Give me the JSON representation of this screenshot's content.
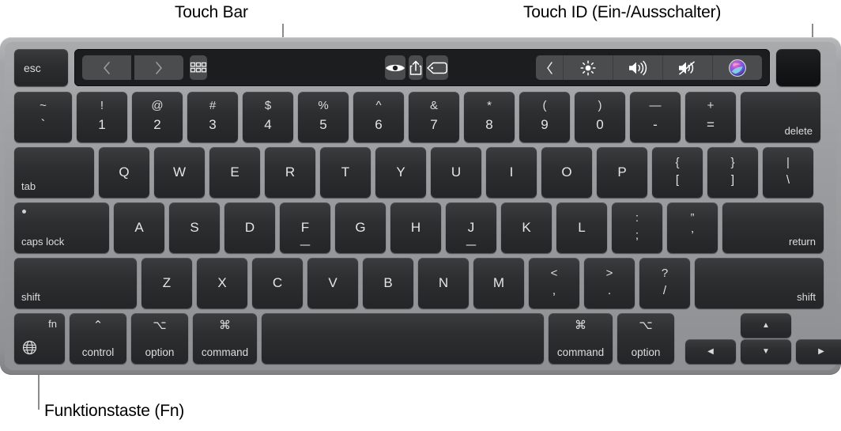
{
  "annotations": {
    "touch_bar": {
      "label": "Touch Bar"
    },
    "touch_id": {
      "label": "Touch ID (Ein-/Ausschalter)"
    },
    "fn_key": {
      "label": "Funktionstaste (Fn)"
    }
  },
  "colors": {
    "body": "#9a9c9f",
    "key": "#2c2e30",
    "key_text": "#e4e5e7",
    "touchbar_bg": "#1c1d1f",
    "touchbar_button": "#4a4c4e",
    "leader_line": "#8c8c8c",
    "siri_purple": "#8a4fd0",
    "siri_pink": "#e05fa8",
    "siri_cyan": "#4fd8e8"
  },
  "touch_bar": {
    "esc_label": "esc",
    "left_buttons": [
      {
        "name": "back-icon",
        "glyph": "‹"
      },
      {
        "name": "forward-icon",
        "glyph": "›"
      },
      {
        "name": "icon-view-grid-icon",
        "glyph": "grid"
      }
    ],
    "center_buttons": [
      {
        "name": "quick-look-eye-icon",
        "glyph": "eye"
      },
      {
        "name": "share-icon",
        "glyph": "share"
      },
      {
        "name": "tag-icon",
        "glyph": "tag"
      }
    ],
    "right_buttons": [
      {
        "name": "expand-control-strip-icon",
        "glyph": "‹"
      },
      {
        "name": "brightness-icon",
        "glyph": "brightness"
      },
      {
        "name": "volume-up-icon",
        "glyph": "volume"
      },
      {
        "name": "mute-icon",
        "glyph": "mute"
      },
      {
        "name": "siri-icon",
        "glyph": "siri"
      }
    ]
  },
  "touch_id": {
    "label": ""
  },
  "rows": {
    "numbers": [
      {
        "name": "key-grave",
        "shifted": "~",
        "main": "`",
        "width": "wide-left"
      },
      {
        "name": "key-1",
        "shifted": "!",
        "main": "1"
      },
      {
        "name": "key-2",
        "shifted": "@",
        "main": "2"
      },
      {
        "name": "key-3",
        "shifted": "#",
        "main": "3"
      },
      {
        "name": "key-4",
        "shifted": "$",
        "main": "4"
      },
      {
        "name": "key-5",
        "shifted": "%",
        "main": "5"
      },
      {
        "name": "key-6",
        "shifted": "^",
        "main": "6"
      },
      {
        "name": "key-7",
        "shifted": "&",
        "main": "7"
      },
      {
        "name": "key-8",
        "shifted": "*",
        "main": "8"
      },
      {
        "name": "key-9",
        "shifted": "(",
        "main": "9"
      },
      {
        "name": "key-0",
        "shifted": ")",
        "main": "0"
      },
      {
        "name": "key-minus",
        "shifted": "—",
        "main": "-"
      },
      {
        "name": "key-equals",
        "shifted": "+",
        "main": "="
      },
      {
        "name": "key-delete",
        "main": "delete",
        "width": "wide-right"
      }
    ],
    "qwerty": [
      {
        "name": "key-tab",
        "main": "tab",
        "width": "wide-left"
      },
      {
        "name": "key-q",
        "main": "Q"
      },
      {
        "name": "key-w",
        "main": "W"
      },
      {
        "name": "key-e",
        "main": "E"
      },
      {
        "name": "key-r",
        "main": "R"
      },
      {
        "name": "key-t",
        "main": "T"
      },
      {
        "name": "key-y",
        "main": "Y"
      },
      {
        "name": "key-u",
        "main": "U"
      },
      {
        "name": "key-i",
        "main": "I"
      },
      {
        "name": "key-o",
        "main": "O"
      },
      {
        "name": "key-p",
        "main": "P"
      },
      {
        "name": "key-bracket-left",
        "shifted": "{",
        "main": "["
      },
      {
        "name": "key-bracket-right",
        "shifted": "}",
        "main": "]"
      },
      {
        "name": "key-backslash",
        "shifted": "|",
        "main": "\\"
      }
    ],
    "home": [
      {
        "name": "key-caps-lock",
        "main": "caps lock",
        "width": "wide-left"
      },
      {
        "name": "key-a",
        "main": "A"
      },
      {
        "name": "key-s",
        "main": "S"
      },
      {
        "name": "key-d",
        "main": "D"
      },
      {
        "name": "key-f",
        "main": "F",
        "homing": true
      },
      {
        "name": "key-g",
        "main": "G"
      },
      {
        "name": "key-h",
        "main": "H"
      },
      {
        "name": "key-j",
        "main": "J",
        "homing": true
      },
      {
        "name": "key-k",
        "main": "K"
      },
      {
        "name": "key-l",
        "main": "L"
      },
      {
        "name": "key-semicolon",
        "shifted": ":",
        "main": ";"
      },
      {
        "name": "key-quote",
        "shifted": "”",
        "main": "’"
      },
      {
        "name": "key-return",
        "main": "return",
        "width": "wide-right"
      }
    ],
    "shift": [
      {
        "name": "key-shift-left",
        "main": "shift",
        "width": "wide-left"
      },
      {
        "name": "key-z",
        "main": "Z"
      },
      {
        "name": "key-x",
        "main": "X"
      },
      {
        "name": "key-c",
        "main": "C"
      },
      {
        "name": "key-v",
        "main": "V"
      },
      {
        "name": "key-b",
        "main": "B"
      },
      {
        "name": "key-n",
        "main": "N"
      },
      {
        "name": "key-m",
        "main": "M"
      },
      {
        "name": "key-comma",
        "shifted": "<",
        "main": ","
      },
      {
        "name": "key-period",
        "shifted": ">",
        "main": "."
      },
      {
        "name": "key-slash",
        "shifted": "?",
        "main": "/"
      },
      {
        "name": "key-shift-right",
        "main": "shift",
        "width": "wide-right"
      }
    ],
    "bottom": {
      "fn": {
        "name": "key-fn",
        "label": "fn",
        "icon": "globe-icon"
      },
      "control": {
        "name": "key-control",
        "symbol": "⌃",
        "label": "control"
      },
      "option_left": {
        "name": "key-option-left",
        "symbol": "⌥",
        "label": "option"
      },
      "command_left": {
        "name": "key-command-left",
        "symbol": "⌘",
        "label": "command"
      },
      "space": {
        "name": "key-space",
        "label": ""
      },
      "command_right": {
        "name": "key-command-right",
        "symbol": "⌘",
        "label": "command"
      },
      "option_right": {
        "name": "key-option-right",
        "symbol": "⌥",
        "label": "option"
      },
      "arrow_left": {
        "name": "key-arrow-left",
        "glyph": "◀"
      },
      "arrow_up": {
        "name": "key-arrow-up",
        "glyph": "▲"
      },
      "arrow_down": {
        "name": "key-arrow-down",
        "glyph": "▼"
      },
      "arrow_right": {
        "name": "key-arrow-right",
        "glyph": "▶"
      }
    }
  }
}
